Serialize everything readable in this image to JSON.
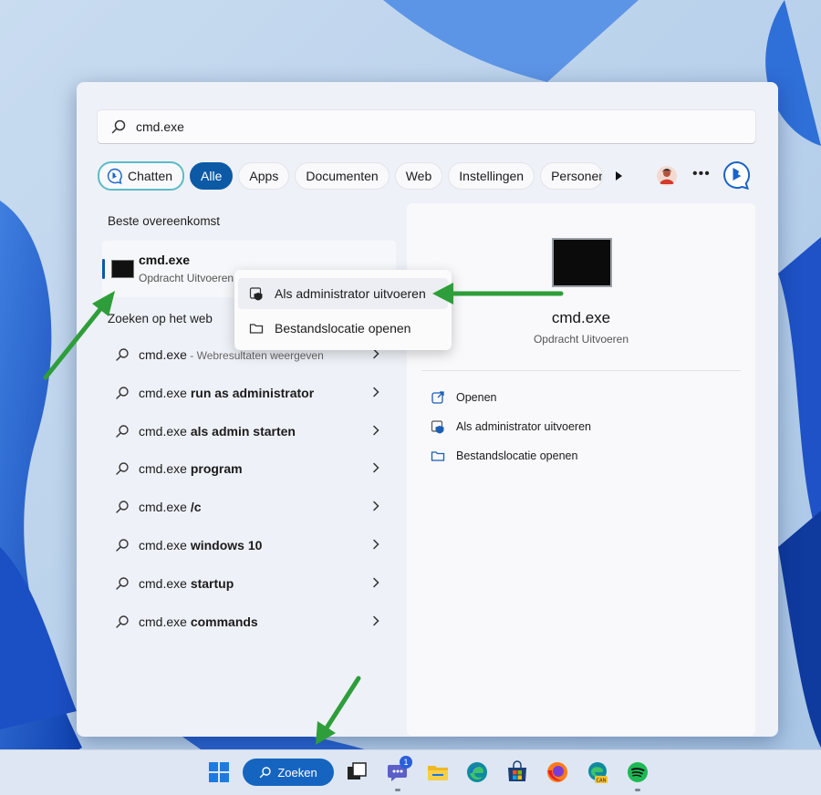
{
  "search": {
    "query": "cmd.exe"
  },
  "filters": {
    "chat": "Chatten",
    "all": "Alle",
    "apps": "Apps",
    "documents": "Documenten",
    "web": "Web",
    "settings": "Instellingen",
    "people": "Personen"
  },
  "best_match": {
    "section": "Beste overeenkomst",
    "title": "cmd.exe",
    "subtitle": "Opdracht Uitvoeren"
  },
  "web_search": {
    "section": "Zoeken op het web",
    "items": [
      {
        "prefix": "cmd.exe",
        "bold": "",
        "hint": " - Webresultaten weergeven"
      },
      {
        "prefix": "cmd.exe ",
        "bold": "run as administrator",
        "hint": ""
      },
      {
        "prefix": "cmd.exe ",
        "bold": "als admin starten",
        "hint": ""
      },
      {
        "prefix": "cmd.exe ",
        "bold": "program",
        "hint": ""
      },
      {
        "prefix": "cmd.exe ",
        "bold": "/c",
        "hint": ""
      },
      {
        "prefix": "cmd.exe ",
        "bold": "windows 10",
        "hint": ""
      },
      {
        "prefix": "cmd.exe ",
        "bold": "startup",
        "hint": ""
      },
      {
        "prefix": "cmd.exe ",
        "bold": "commands",
        "hint": ""
      }
    ]
  },
  "context_menu": {
    "run_as_admin": "Als administrator uitvoeren",
    "open_location": "Bestandslocatie openen"
  },
  "preview": {
    "title": "cmd.exe",
    "subtitle": "Opdracht Uitvoeren",
    "actions": {
      "open": "Openen",
      "run_as_admin": "Als administrator uitvoeren",
      "open_location": "Bestandslocatie openen"
    }
  },
  "taskbar": {
    "search_label": "Zoeken",
    "teams_badge": "1"
  },
  "colors": {
    "accent": "#0c5aa6",
    "taskbar_search": "#1565c0",
    "annotation_arrow": "#2e9e3a"
  }
}
